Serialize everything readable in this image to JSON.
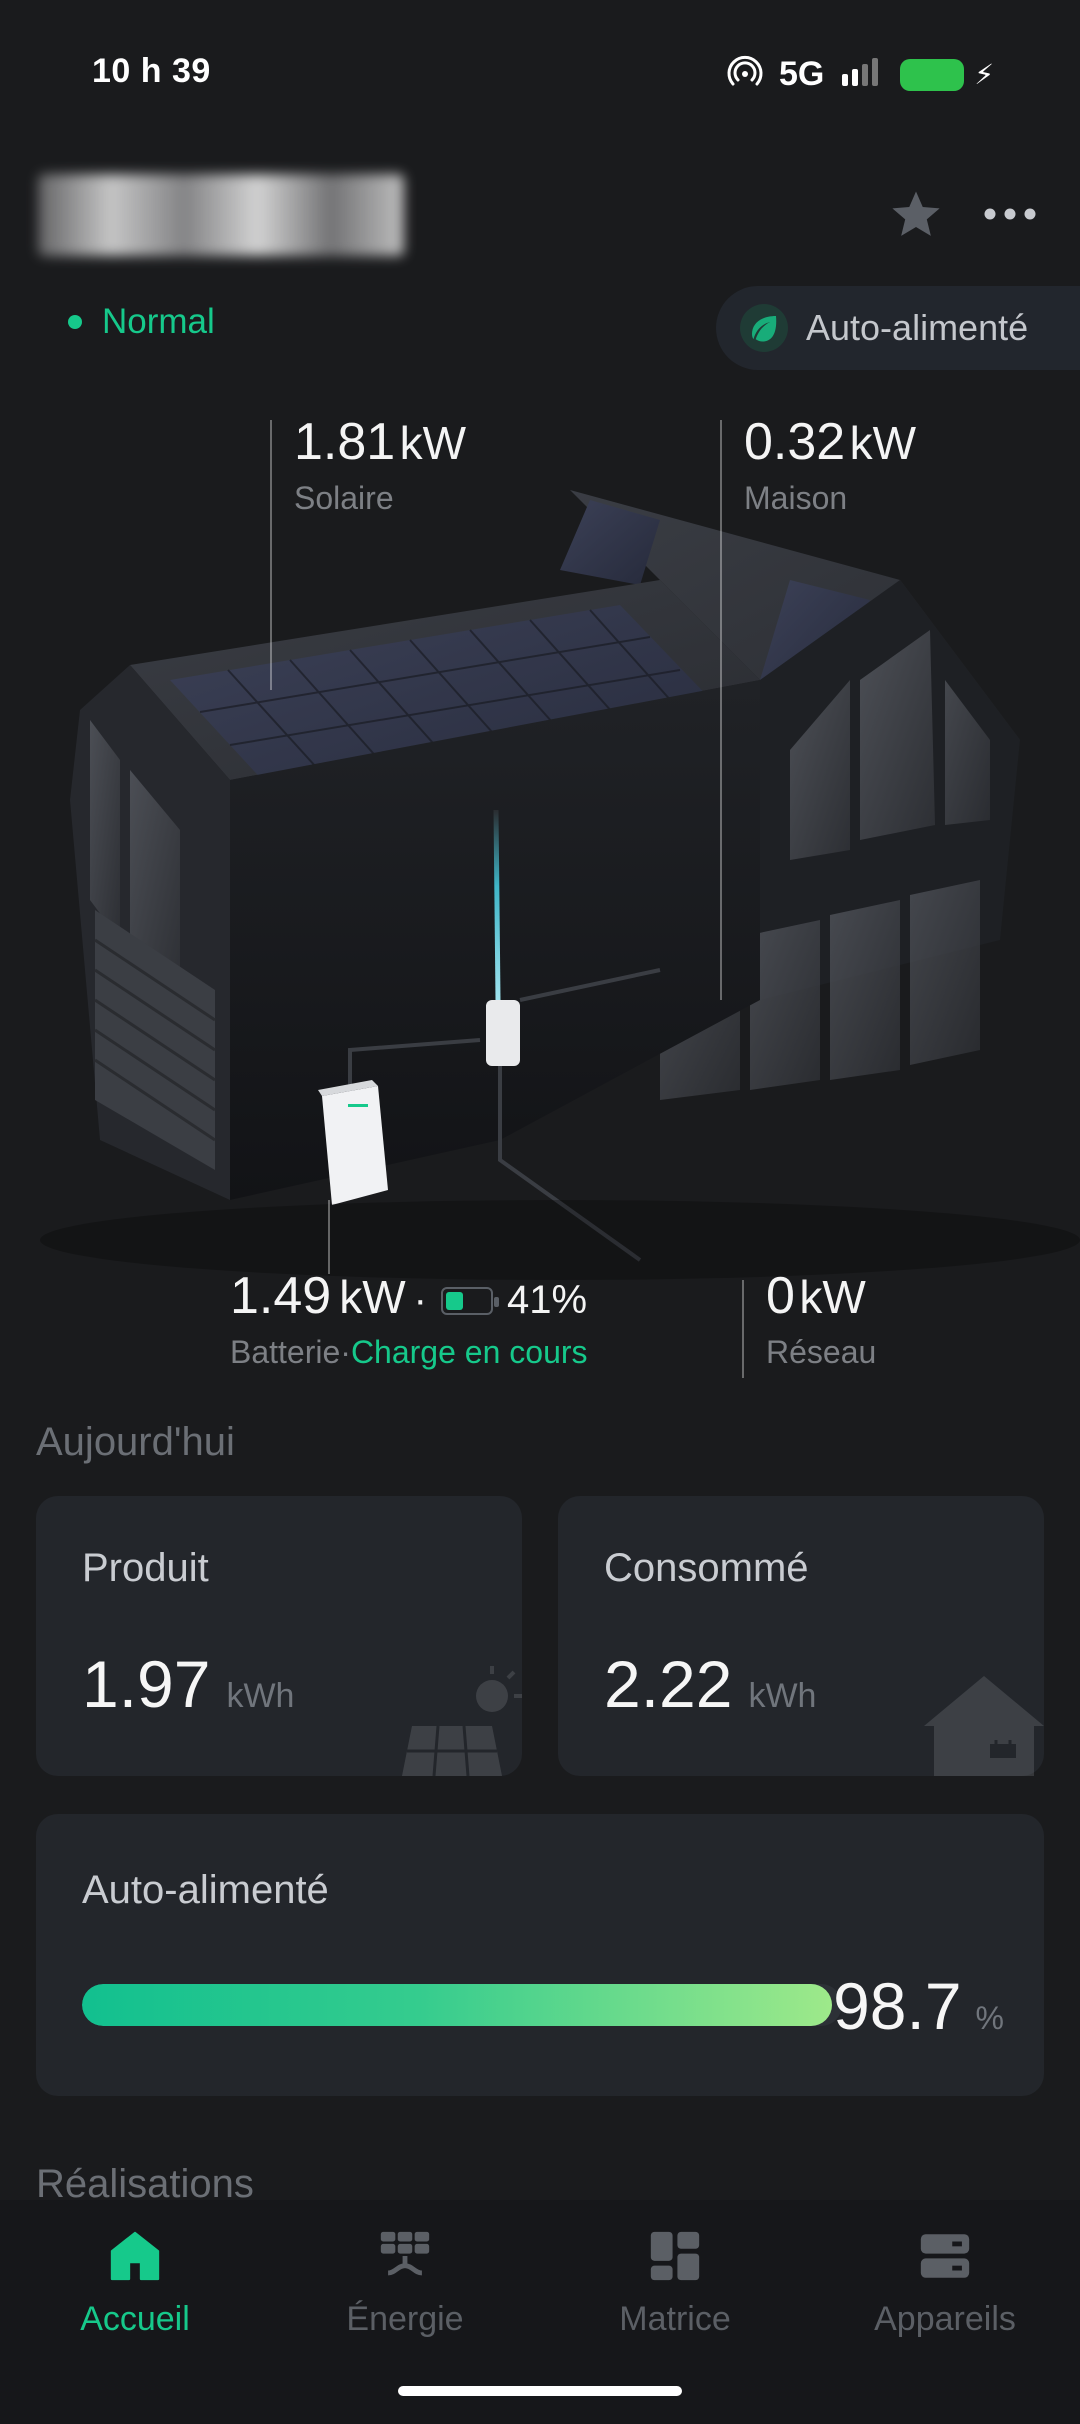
{
  "status_bar": {
    "time": "10 h 39",
    "network": "5G",
    "icons": [
      "hotspot-icon",
      "signal-icon",
      "battery-charging-icon"
    ],
    "battery_color": "#2ec24c"
  },
  "header": {
    "name_blurred": true,
    "star_icon": "star-icon",
    "more_icon": "more-icon"
  },
  "status": {
    "label": "Normal",
    "color": "#16c98b"
  },
  "self_powered_badge": {
    "label": "Auto-alimenté",
    "icon": "leaf-icon"
  },
  "metrics": {
    "solar": {
      "value": "1.81",
      "unit": "kW",
      "label": "Solaire"
    },
    "home": {
      "value": "0.32",
      "unit": "kW",
      "label": "Maison"
    },
    "battery": {
      "value": "1.49",
      "unit": "kW",
      "sep": "·",
      "percent": "41%",
      "percent_value": 41,
      "label": "Batterie",
      "label_sep": "·",
      "state": "Charge en cours"
    },
    "grid": {
      "value": "0",
      "unit": "kW",
      "label": "Réseau"
    }
  },
  "today": {
    "title": "Aujourd'hui",
    "produced": {
      "title": "Produit",
      "value": "1.97",
      "unit": "kWh",
      "icon": "solar-panel-icon"
    },
    "consumed": {
      "title": "Consommé",
      "value": "2.22",
      "unit": "kWh",
      "icon": "house-plug-icon"
    },
    "self_powered": {
      "title": "Auto-alimenté",
      "value": "98.7",
      "unit": "%",
      "progress": 0.987
    }
  },
  "achievements": {
    "title": "Réalisations"
  },
  "nav": [
    {
      "label": "Accueil",
      "icon": "home-icon",
      "active": true
    },
    {
      "label": "Énergie",
      "icon": "energy-icon",
      "active": false
    },
    {
      "label": "Matrice",
      "icon": "matrix-icon",
      "active": false
    },
    {
      "label": "Appareils",
      "icon": "devices-icon",
      "active": false
    }
  ],
  "accent_color": "#16c98b"
}
